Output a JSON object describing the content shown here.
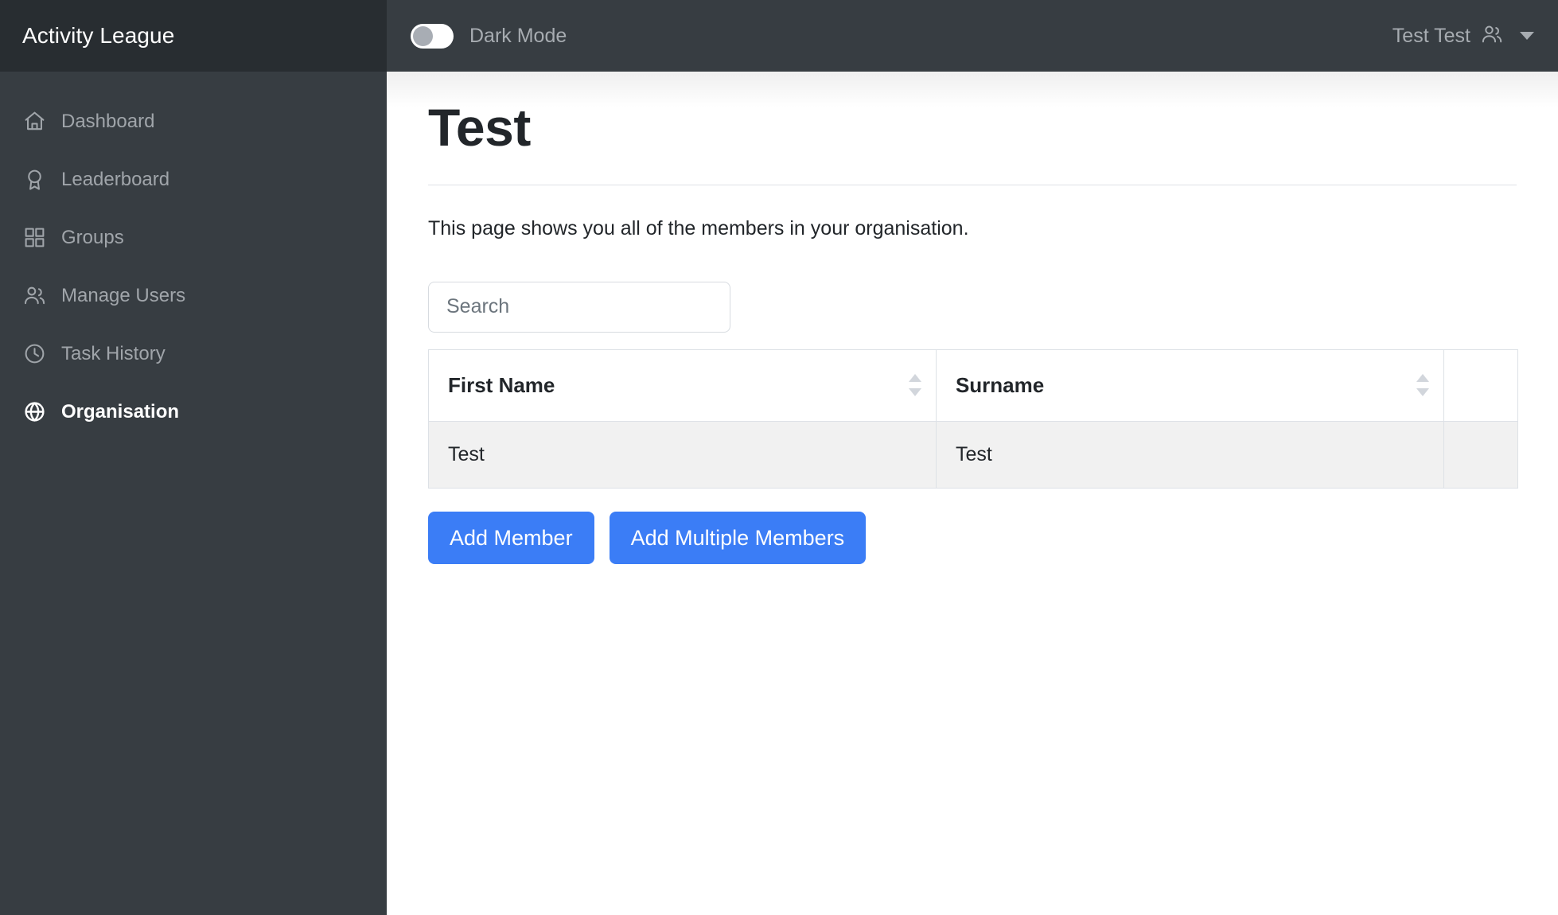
{
  "sidebar": {
    "brand": "Activity League",
    "items": [
      {
        "label": "Dashboard",
        "icon": "home-icon",
        "active": false
      },
      {
        "label": "Leaderboard",
        "icon": "award-icon",
        "active": false
      },
      {
        "label": "Groups",
        "icon": "grid-icon",
        "active": false
      },
      {
        "label": "Manage Users",
        "icon": "users-icon",
        "active": false
      },
      {
        "label": "Task History",
        "icon": "clock-icon",
        "active": false
      },
      {
        "label": "Organisation",
        "icon": "globe-icon",
        "active": true
      }
    ]
  },
  "topbar": {
    "dark_mode_label": "Dark Mode",
    "dark_mode_on": false,
    "user_name": "Test Test"
  },
  "page": {
    "title": "Test",
    "description": "This page shows you all of the members in your organisation."
  },
  "search": {
    "placeholder": "Search",
    "value": ""
  },
  "table": {
    "columns": [
      "First Name",
      "Surname",
      ""
    ],
    "rows": [
      {
        "first_name": "Test",
        "surname": "Test",
        "action": ""
      }
    ]
  },
  "actions": {
    "add_member": "Add Member",
    "add_multiple_members": "Add Multiple Members"
  },
  "colors": {
    "sidebar_bg": "#373d42",
    "sidebar_brand_bg": "#282d31",
    "accent_blue": "#3b7df6",
    "muted_text": "#a7acb1",
    "row_stripe": "#f1f1f1"
  }
}
